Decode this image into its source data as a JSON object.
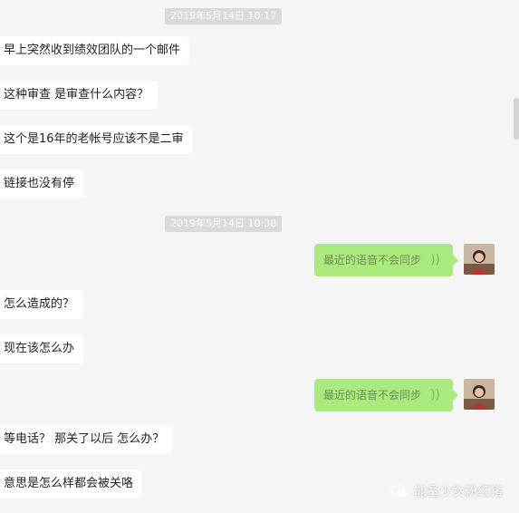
{
  "timestamps": [
    "2019年5月14日 10:17",
    "2019年5月14日 10:38"
  ],
  "messages_block1": [
    "早上突然收到绩效团队的一个邮件",
    "这种审查 是审查什么内容？",
    "这个是16年的老帐号应该不是二审",
    "链接也没有停"
  ],
  "voice_messages": [
    {
      "text": "最近的语音不会同步",
      "icon": "voice-wave-icon"
    },
    {
      "text": "最近的语音不会同步",
      "icon": "voice-wave-icon"
    }
  ],
  "messages_block2": [
    "怎么造成的？",
    "现在该怎么办"
  ],
  "messages_block3": [
    "等电话？  那关了以后 怎么办？",
    "意思是怎么样都会被关咯"
  ],
  "watermark": {
    "text": "能量少女粉红猪",
    "icon": "wechat-official-account-icon"
  },
  "colors": {
    "background": "#f5f5f5",
    "incoming_bubble": "#ffffff",
    "outgoing_bubble": "#a9e97d",
    "timestamp_bg": "#dadada"
  }
}
